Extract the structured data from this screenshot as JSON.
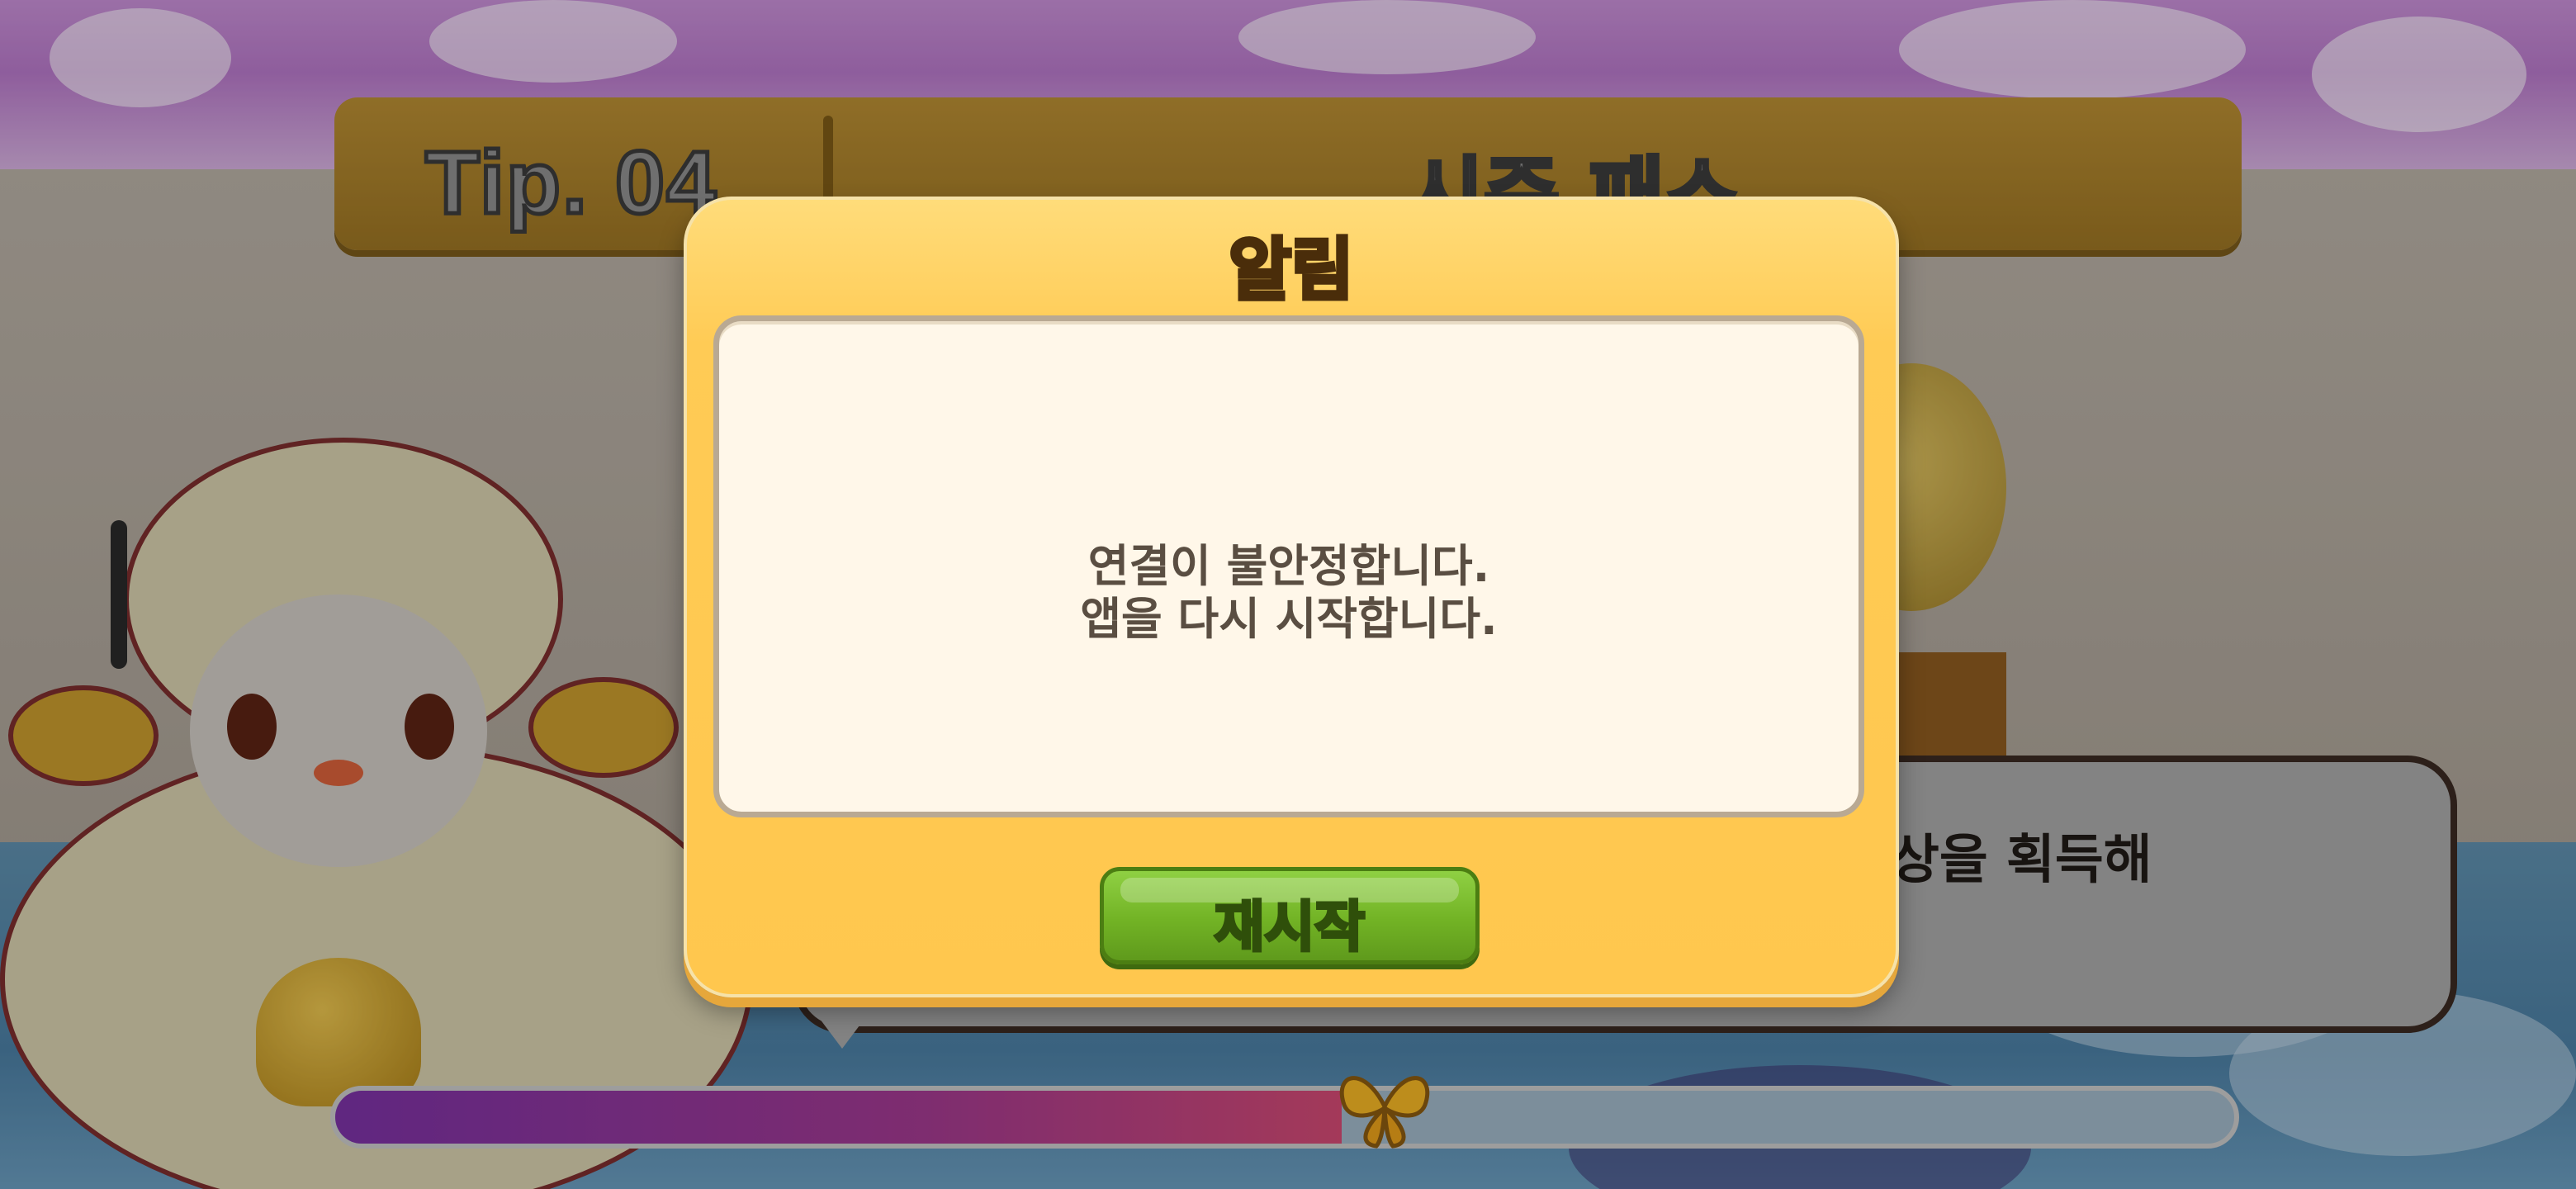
{
  "tip_banner": {
    "label": "Tip. 04",
    "title": "시즌 패스"
  },
  "speech_bubble": {
    "text": "상을 획득해"
  },
  "progress": {
    "fraction": 0.53
  },
  "dialog": {
    "title": "알림",
    "message_line1": "연결이 불안정합니다.",
    "message_line2": "앱을 다시 시작합니다.",
    "restart_label": "재시작"
  },
  "colors": {
    "dialog_accent": "#ffc74e",
    "button_green": "#72b325",
    "progress_purple": "#7b32a5"
  }
}
